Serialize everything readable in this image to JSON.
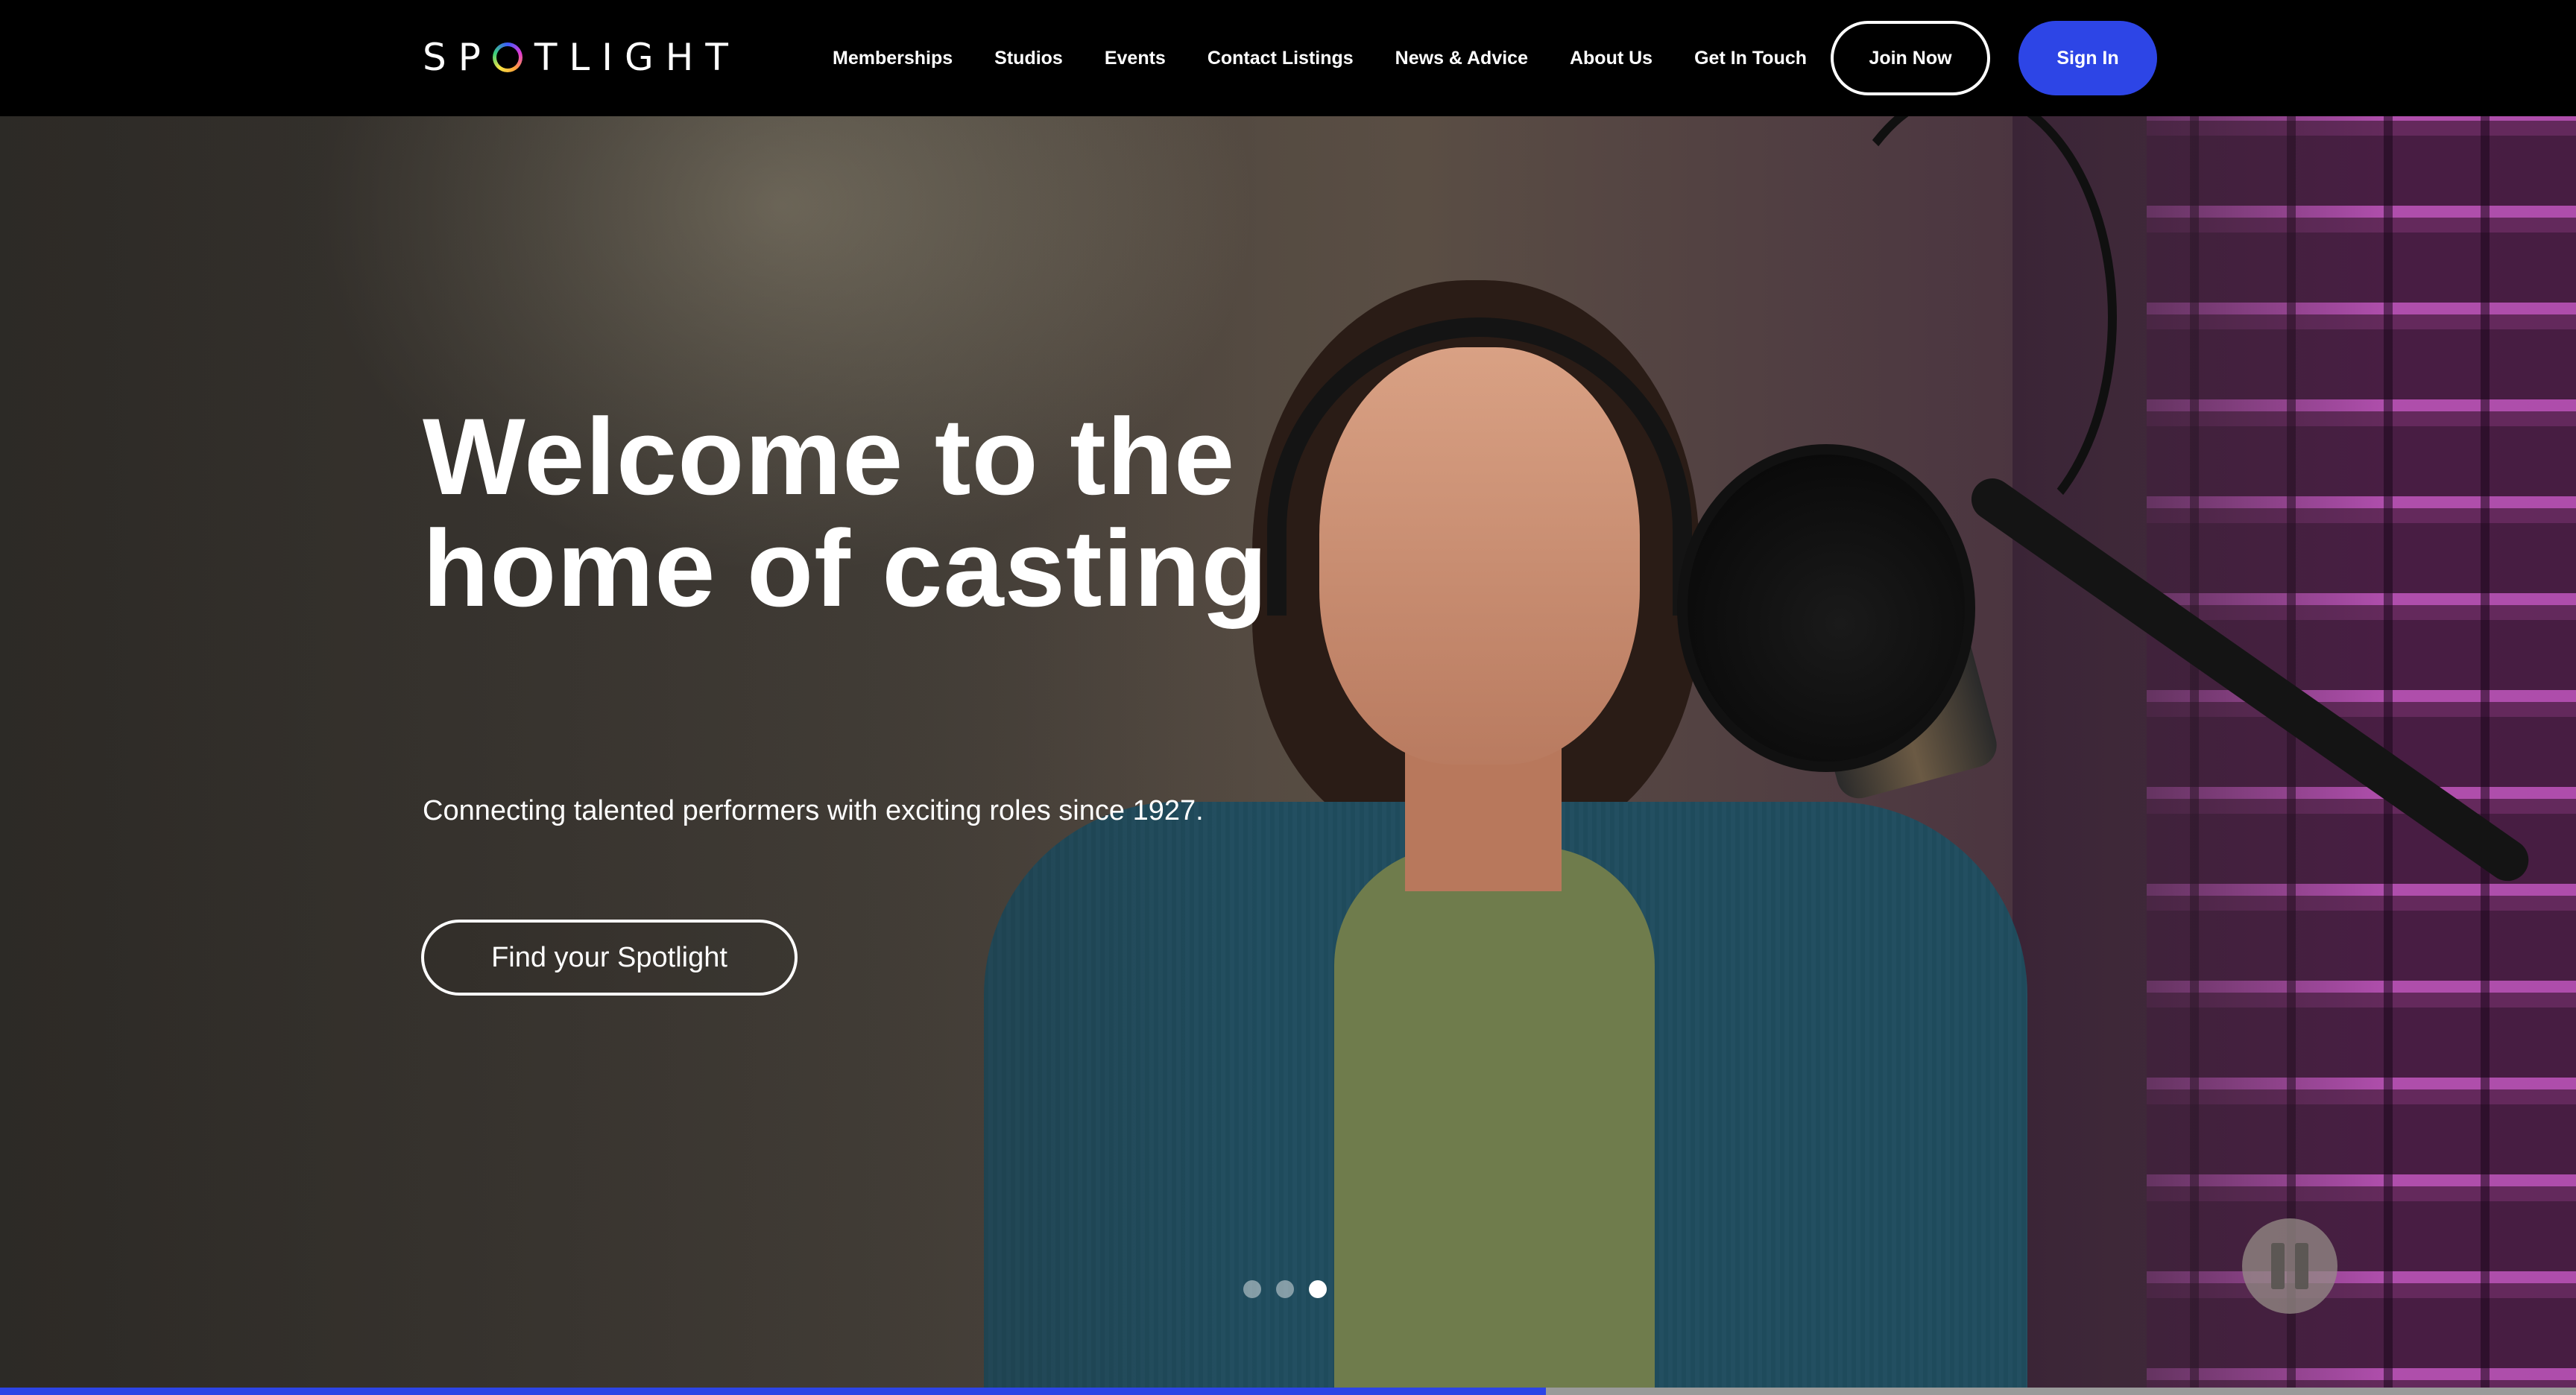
{
  "header": {
    "logo_text": "SPOTLIGHT",
    "logo_first": "SP",
    "logo_rest": "TLIGHT",
    "nav": [
      {
        "label": "Memberships"
      },
      {
        "label": "Studios"
      },
      {
        "label": "Events"
      },
      {
        "label": "Contact Listings"
      },
      {
        "label": "News & Advice"
      },
      {
        "label": "About Us"
      },
      {
        "label": "Get In Touch"
      }
    ],
    "join_label": "Join Now",
    "signin_label": "Sign In"
  },
  "hero": {
    "title_line1": "Welcome to the",
    "title_line2": "home of casting",
    "subtitle": "Connecting talented performers with exciting roles since 1927.",
    "cta_label": "Find your Spotlight",
    "slides_total": 3,
    "active_slide": 3,
    "progress": 0.6
  },
  "colors": {
    "accent": "#2d45e6",
    "header_bg": "#000000"
  },
  "icons": {
    "pause": "pause-icon",
    "logo_ring": "rainbow-ring-icon"
  }
}
